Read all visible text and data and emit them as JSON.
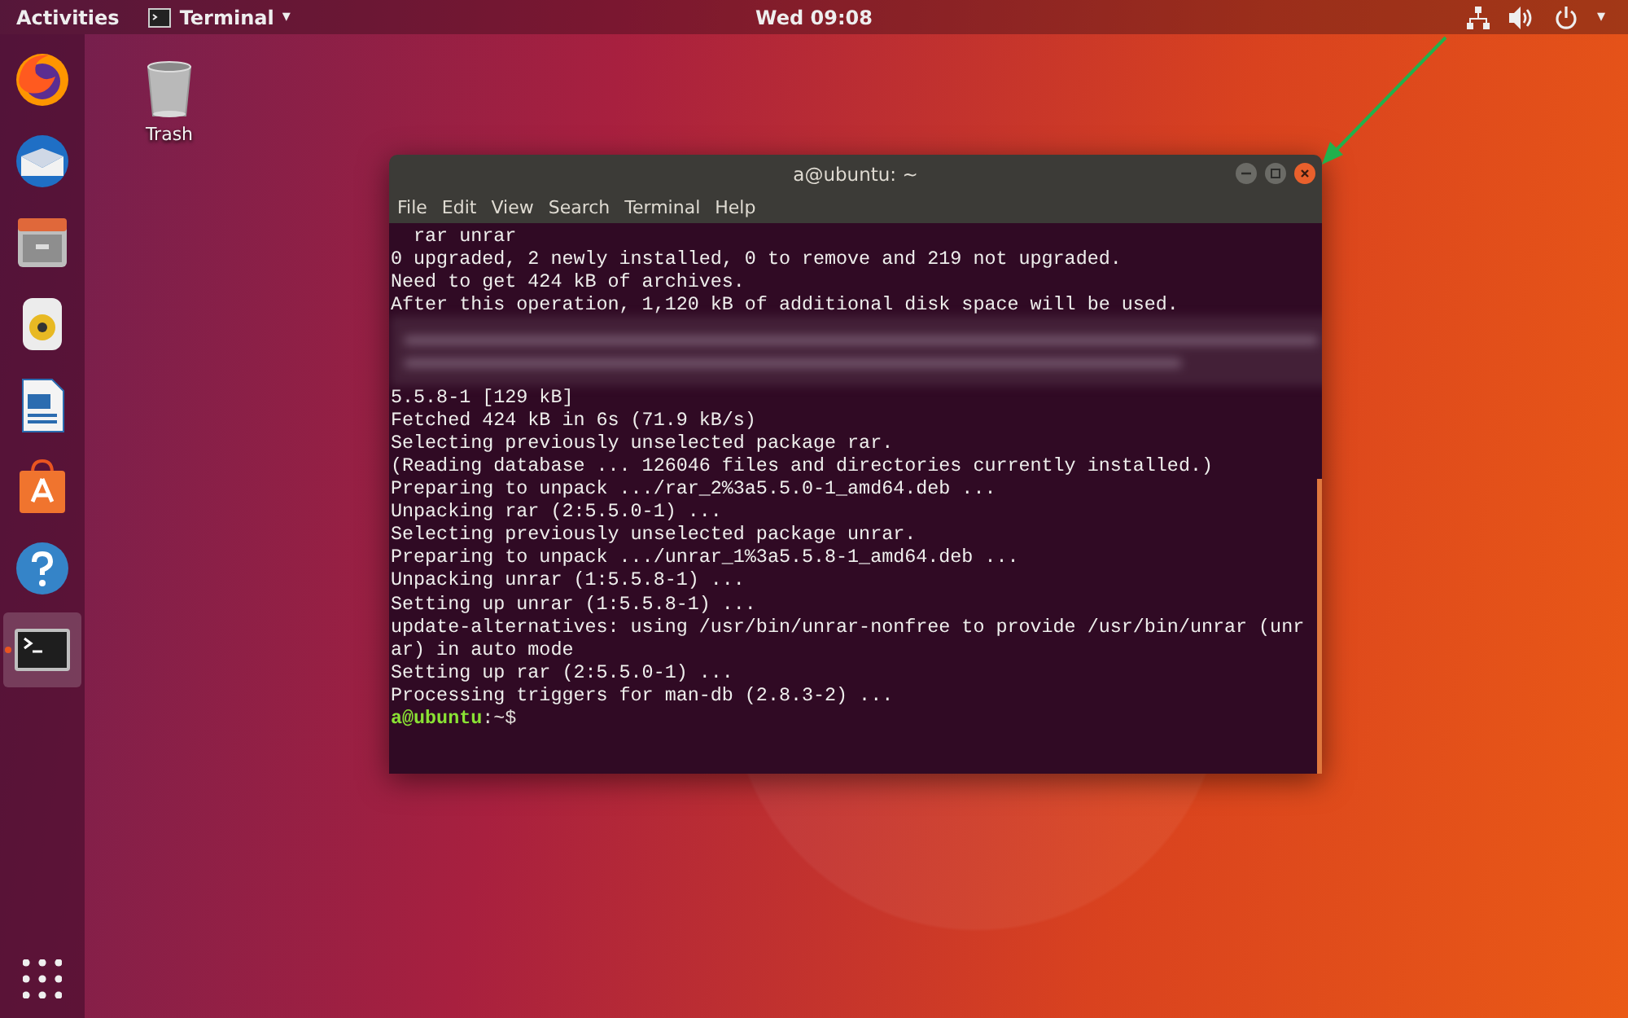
{
  "top_bar": {
    "activities": "Activities",
    "app_menu": {
      "label": "Terminal",
      "caret": "▾"
    },
    "clock": "Wed 09:08",
    "tray_caret": "▾"
  },
  "dock": {
    "items": [
      {
        "kind": "firefox",
        "selected": false,
        "running": false
      },
      {
        "kind": "thunderbird",
        "selected": false,
        "running": false
      },
      {
        "kind": "files",
        "selected": false,
        "running": false
      },
      {
        "kind": "rhythmbox",
        "selected": false,
        "running": false
      },
      {
        "kind": "writer",
        "selected": false,
        "running": false
      },
      {
        "kind": "software",
        "selected": false,
        "running": false
      },
      {
        "kind": "help",
        "selected": false,
        "running": false
      },
      {
        "kind": "terminal",
        "selected": true,
        "running": true
      }
    ]
  },
  "desktop_icons": [
    {
      "label": "Trash"
    }
  ],
  "terminal_window": {
    "title": "a@ubuntu: ~",
    "menu": [
      "File",
      "Edit",
      "View",
      "Search",
      "Terminal",
      "Help"
    ],
    "lines": [
      {
        "kind": "text",
        "text": "  rar unrar"
      },
      {
        "kind": "text",
        "text": "0 upgraded, 2 newly installed, 0 to remove and 219 not upgraded."
      },
      {
        "kind": "text",
        "text": "Need to get 424 kB of archives."
      },
      {
        "kind": "text",
        "text": "After this operation, 1,120 kB of additional disk space will be used."
      },
      {
        "kind": "blurred"
      },
      {
        "kind": "text",
        "text": "5.5.8-1 [129 kB]"
      },
      {
        "kind": "text",
        "text": "Fetched 424 kB in 6s (71.9 kB/s)"
      },
      {
        "kind": "text",
        "text": "Selecting previously unselected package rar."
      },
      {
        "kind": "text",
        "text": "(Reading database ... 126046 files and directories currently installed.)"
      },
      {
        "kind": "text",
        "text": "Preparing to unpack .../rar_2%3a5.5.0-1_amd64.deb ..."
      },
      {
        "kind": "text",
        "text": "Unpacking rar (2:5.5.0-1) ..."
      },
      {
        "kind": "text",
        "text": "Selecting previously unselected package unrar."
      },
      {
        "kind": "text",
        "text": "Preparing to unpack .../unrar_1%3a5.5.8-1_amd64.deb ..."
      },
      {
        "kind": "text",
        "text": "Unpacking unrar (1:5.5.8-1) ..."
      },
      {
        "kind": "text",
        "text": "Setting up unrar (1:5.5.8-1) ..."
      },
      {
        "kind": "text",
        "text": "update-alternatives: using /usr/bin/unrar-nonfree to provide /usr/bin/unrar (unr"
      },
      {
        "kind": "text",
        "text": "ar) in auto mode"
      },
      {
        "kind": "text",
        "text": "Setting up rar (2:5.5.0-1) ..."
      },
      {
        "kind": "text",
        "text": "Processing triggers for man-db (2.8.3-2) ..."
      },
      {
        "kind": "prompt",
        "segments": [
          {
            "text": "a@ubuntu",
            "color": "#8ae234"
          },
          {
            "text": ":~$",
            "color": "#e0dcd8"
          }
        ]
      }
    ]
  }
}
